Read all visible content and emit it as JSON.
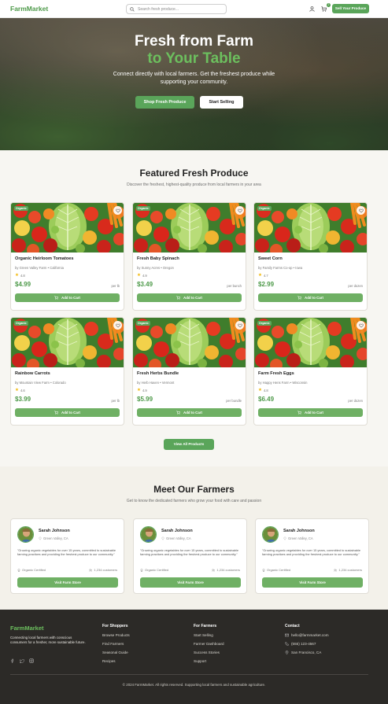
{
  "header": {
    "brand": "FarmMarket",
    "search_placeholder": "Search fresh produce...",
    "cart_count": "2",
    "sell_button": "Sell Your Produce",
    "icons": [
      "user-icon",
      "cart-icon"
    ]
  },
  "hero": {
    "title_line1": "Fresh from Farm",
    "title_line2": "to Your Table",
    "subtitle": "Connect directly with local farmers. Get the freshest produce while supporting your community.",
    "primary_button": "Shop Fresh Produce",
    "secondary_button": "Start Selling"
  },
  "featured": {
    "title": "Featured Fresh Produce",
    "subtitle": "Discover the freshest, highest-quality produce from local farmers in your area",
    "add_to_cart": "Add to Cart",
    "badge": "Organic",
    "products": [
      {
        "name": "Organic Heirloom Tomatoes",
        "farm": "by Green Valley Farm • California",
        "rating": "4.8",
        "price": "$4.99",
        "unit": "per lb"
      },
      {
        "name": "Fresh Baby Spinach",
        "farm": "by Sunny Acres • Oregon",
        "rating": "4.9",
        "price": "$3.49",
        "unit": "per bunch"
      },
      {
        "name": "Sweet Corn",
        "farm": "by Family Farms Co-op • Iowa",
        "rating": "4.7",
        "price": "$2.99",
        "unit": "per dozen"
      },
      {
        "name": "Rainbow Carrots",
        "farm": "by Mountain View Farm • Colorado",
        "rating": "4.6",
        "price": "$3.99",
        "unit": "per lb"
      },
      {
        "name": "Fresh Herbs Bundle",
        "farm": "by Herb Haven • Vermont",
        "rating": "4.9",
        "price": "$5.99",
        "unit": "per bundle"
      },
      {
        "name": "Farm Fresh Eggs",
        "farm": "by Happy Hens Farm • Wisconsin",
        "rating": "4.8",
        "price": "$6.49",
        "unit": "per dozen"
      }
    ],
    "view_all": "View All Products"
  },
  "farmers": {
    "title": "Meet Our Farmers",
    "subtitle": "Get to know the dedicated farmers who grow your food with care and passion",
    "button": "Visit Farm Store",
    "list": [
      {
        "name": "Sarah Johnson",
        "location": "Green Valley, CA",
        "quote": "\"Growing organic vegetables for over 15 years, committed to sustainable farming practices and providing the freshest produce to our community.\"",
        "cert": "Organic Certified",
        "customers": "1,234 customers"
      },
      {
        "name": "Sarah Johnson",
        "location": "Green Valley, CA",
        "quote": "\"Growing organic vegetables for over 15 years, committed to sustainable farming practices and providing the freshest produce to our community.\"",
        "cert": "Organic Certified",
        "customers": "1,234 customers"
      },
      {
        "name": "Sarah Johnson",
        "location": "Green Valley, CA",
        "quote": "\"Growing organic vegetables for over 15 years, committed to sustainable farming practices and providing the freshest produce to our community.\"",
        "cert": "Organic Certified",
        "customers": "1,234 customers"
      }
    ]
  },
  "footer": {
    "brand": "FarmMarket",
    "description": "Connecting local farmers with conscious consumers for a fresher, more sustainable future.",
    "social_icons": [
      "facebook-icon",
      "twitter-icon",
      "instagram-icon"
    ],
    "shoppers": {
      "title": "For Shoppers",
      "items": [
        "Browse Products",
        "Find Farmers",
        "Seasonal Guide",
        "Recipes"
      ]
    },
    "farmers": {
      "title": "For Farmers",
      "items": [
        "Start Selling",
        "Farmer Dashboard",
        "Success Stories",
        "Support"
      ]
    },
    "contact": {
      "title": "Contact",
      "email": "hello@farmmarket.com",
      "phone": "(555) 123-4567",
      "location": "San Francisco, CA"
    },
    "copyright": "© 2024 FarmMarket. All rights reserved. Supporting local farmers and sustainable agriculture."
  },
  "colors": {
    "brand_green": "#5aa55a",
    "footer_bg": "#2c2a27",
    "star": "#f2b705"
  }
}
